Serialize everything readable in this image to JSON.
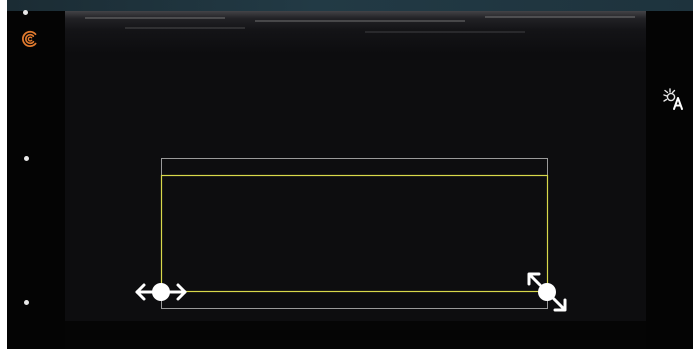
{
  "screen": {
    "logo_icon": "swirl-logo-icon",
    "auto_gain_icon": "auto-brightness-icon",
    "move_handle_icon": "move-horizontal-arrows-icon",
    "resize_handle_icon": "resize-diagonal-arrows-icon"
  },
  "colors": {
    "accent_logo": "#e07a2f",
    "roi_outline": "#d8d84a",
    "roi_outer": "#9a9a9a",
    "handles": "#ffffff",
    "background": "#050505"
  }
}
